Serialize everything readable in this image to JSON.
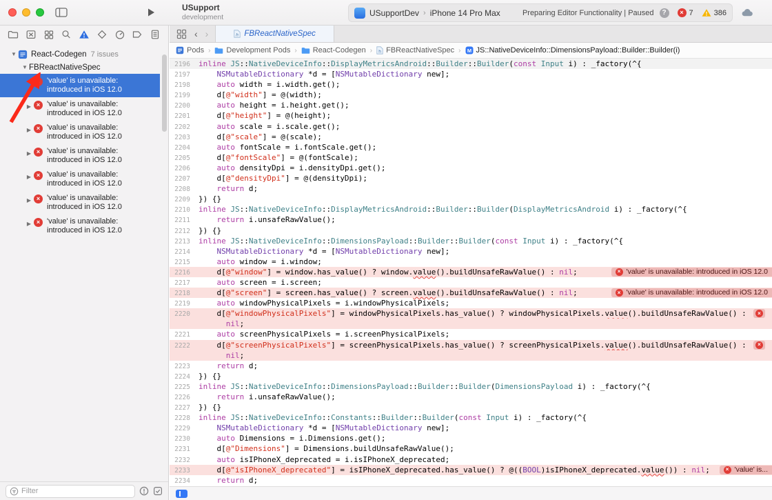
{
  "toolbar": {
    "project_name": "USupport",
    "project_subtitle": "development",
    "scheme": "USupportDev",
    "run_destination": "iPhone 14 Pro Max",
    "status_text": "Preparing Editor Functionality | Paused",
    "error_count": "7",
    "warning_count": "386"
  },
  "navigator": {
    "icons": [
      "project-navigator-icon",
      "source-control-navigator-icon",
      "symbol-navigator-icon",
      "find-navigator-icon",
      "issue-navigator-icon",
      "test-navigator-icon",
      "debug-navigator-icon",
      "breakpoint-navigator-icon",
      "report-navigator-icon"
    ],
    "active_icon": "issue-navigator-icon",
    "root_label": "React-Codegen",
    "root_badge": "7 issues",
    "group_label": "FBReactNativeSpec",
    "issues": [
      {
        "line1": "'value' is unavailable:",
        "line2": "introduced in iOS 12.0",
        "selected": true
      },
      {
        "line1": "'value' is unavailable:",
        "line2": "introduced in iOS 12.0",
        "selected": false
      },
      {
        "line1": "'value' is unavailable:",
        "line2": "introduced in iOS 12.0",
        "selected": false
      },
      {
        "line1": "'value' is unavailable:",
        "line2": "introduced in iOS 12.0",
        "selected": false
      },
      {
        "line1": "'value' is unavailable:",
        "line2": "introduced in iOS 12.0",
        "selected": false
      },
      {
        "line1": "'value' is unavailable:",
        "line2": "introduced in iOS 12.0",
        "selected": false
      },
      {
        "line1": "'value' is unavailable:",
        "line2": "introduced in iOS 12.0",
        "selected": false
      }
    ],
    "filter_placeholder": "Filter"
  },
  "tab": {
    "label": "FBReactNativeSpec"
  },
  "breadcrumb": {
    "items": [
      {
        "label": "Pods",
        "icon": "project"
      },
      {
        "label": "Development Pods",
        "icon": "folder"
      },
      {
        "label": "React-Codegen",
        "icon": "folder"
      },
      {
        "label": "FBReactNativeSpec",
        "icon": "file-h"
      },
      {
        "label": "JS::NativeDeviceInfo::DimensionsPayload::Builder::Builder(i)",
        "icon": "method"
      }
    ]
  },
  "editor": {
    "error_message": "'value' is unavailable: introduced in iOS 12.0",
    "error_short": "'value' is...",
    "lines": [
      {
        "n": "2196",
        "t": "inline JS::NativeDeviceInfo::DisplayMetricsAndroid::Builder::Builder(const Input i) : _factory(^{",
        "pin": true
      },
      {
        "n": "2197",
        "t": "    NSMutableDictionary *d = [NSMutableDictionary new];"
      },
      {
        "n": "2198",
        "t": "    auto width = i.width.get();"
      },
      {
        "n": "2199",
        "t": "    d[@\"width\"] = @(width);"
      },
      {
        "n": "2200",
        "t": "    auto height = i.height.get();"
      },
      {
        "n": "2201",
        "t": "    d[@\"height\"] = @(height);"
      },
      {
        "n": "2202",
        "t": "    auto scale = i.scale.get();"
      },
      {
        "n": "2203",
        "t": "    d[@\"scale\"] = @(scale);"
      },
      {
        "n": "2204",
        "t": "    auto fontScale = i.fontScale.get();"
      },
      {
        "n": "2205",
        "t": "    d[@\"fontScale\"] = @(fontScale);"
      },
      {
        "n": "2206",
        "t": "    auto densityDpi = i.densityDpi.get();"
      },
      {
        "n": "2207",
        "t": "    d[@\"densityDpi\"] = @(densityDpi);"
      },
      {
        "n": "2208",
        "t": "    return d;"
      },
      {
        "n": "2209",
        "t": "}) {}"
      },
      {
        "n": "2210",
        "t": "inline JS::NativeDeviceInfo::DisplayMetricsAndroid::Builder::Builder(DisplayMetricsAndroid i) : _factory(^{"
      },
      {
        "n": "2211",
        "t": "    return i.unsafeRawValue();"
      },
      {
        "n": "2212",
        "t": "}) {}"
      },
      {
        "n": "2213",
        "t": "inline JS::NativeDeviceInfo::DimensionsPayload::Builder::Builder(const Input i) : _factory(^{"
      },
      {
        "n": "2214",
        "t": "    NSMutableDictionary *d = [NSMutableDictionary new];"
      },
      {
        "n": "2215",
        "t": "    auto window = i.window;"
      },
      {
        "n": "2216",
        "t": "    d[@\"window\"] = window.has_value() ? window.value().buildUnsafeRawValue() : nil;",
        "e": true,
        "b": "full"
      },
      {
        "n": "2217",
        "t": "    auto screen = i.screen;"
      },
      {
        "n": "2218",
        "t": "    d[@\"screen\"] = screen.has_value() ? screen.value().buildUnsafeRawValue() : nil;",
        "e": true,
        "b": "full"
      },
      {
        "n": "2219",
        "t": "    auto windowPhysicalPixels = i.windowPhysicalPixels;"
      },
      {
        "n": "2220",
        "t": "    d[@\"windowPhysicalPixels\"] = windowPhysicalPixels.has_value() ? windowPhysicalPixels.value().buildUnsafeRawValue() :",
        "e": true,
        "b": "icon"
      },
      {
        "n": "",
        "t": "      nil;",
        "e": true
      },
      {
        "n": "2221",
        "t": "    auto screenPhysicalPixels = i.screenPhysicalPixels;"
      },
      {
        "n": "2222",
        "t": "    d[@\"screenPhysicalPixels\"] = screenPhysicalPixels.has_value() ? screenPhysicalPixels.value().buildUnsafeRawValue() :",
        "e": true,
        "b": "icon"
      },
      {
        "n": "",
        "t": "      nil;",
        "e": true
      },
      {
        "n": "2223",
        "t": "    return d;"
      },
      {
        "n": "2224",
        "t": "}) {}"
      },
      {
        "n": "2225",
        "t": "inline JS::NativeDeviceInfo::DimensionsPayload::Builder::Builder(DimensionsPayload i) : _factory(^{"
      },
      {
        "n": "2226",
        "t": "    return i.unsafeRawValue();"
      },
      {
        "n": "2227",
        "t": "}) {}"
      },
      {
        "n": "2228",
        "t": "inline JS::NativeDeviceInfo::Constants::Builder::Builder(const Input i) : _factory(^{"
      },
      {
        "n": "2229",
        "t": "    NSMutableDictionary *d = [NSMutableDictionary new];"
      },
      {
        "n": "2230",
        "t": "    auto Dimensions = i.Dimensions.get();"
      },
      {
        "n": "2231",
        "t": "    d[@\"Dimensions\"] = Dimensions.buildUnsafeRawValue();"
      },
      {
        "n": "2232",
        "t": "    auto isIPhoneX_deprecated = i.isIPhoneX_deprecated;"
      },
      {
        "n": "2233",
        "t": "    d[@\"isIPhoneX_deprecated\"] = isIPhoneX_deprecated.has_value() ? @((BOOL)isIPhoneX_deprecated.value()) : nil;",
        "e": true,
        "b": "short"
      },
      {
        "n": "2234",
        "t": "    return d;"
      }
    ]
  },
  "colors": {
    "selection_blue": "#3b76d6",
    "accent_blue": "#2e6ee0",
    "error_red": "#e13c36",
    "warning_yellow": "#f7b500",
    "error_line_bg": "#fbe0de",
    "error_badge_bg": "#eeb9b7",
    "keyword_pink": "#ad3da4",
    "type_teal": "#3e8087",
    "sdk_purple": "#703daa",
    "string_red": "#d12f1b"
  }
}
